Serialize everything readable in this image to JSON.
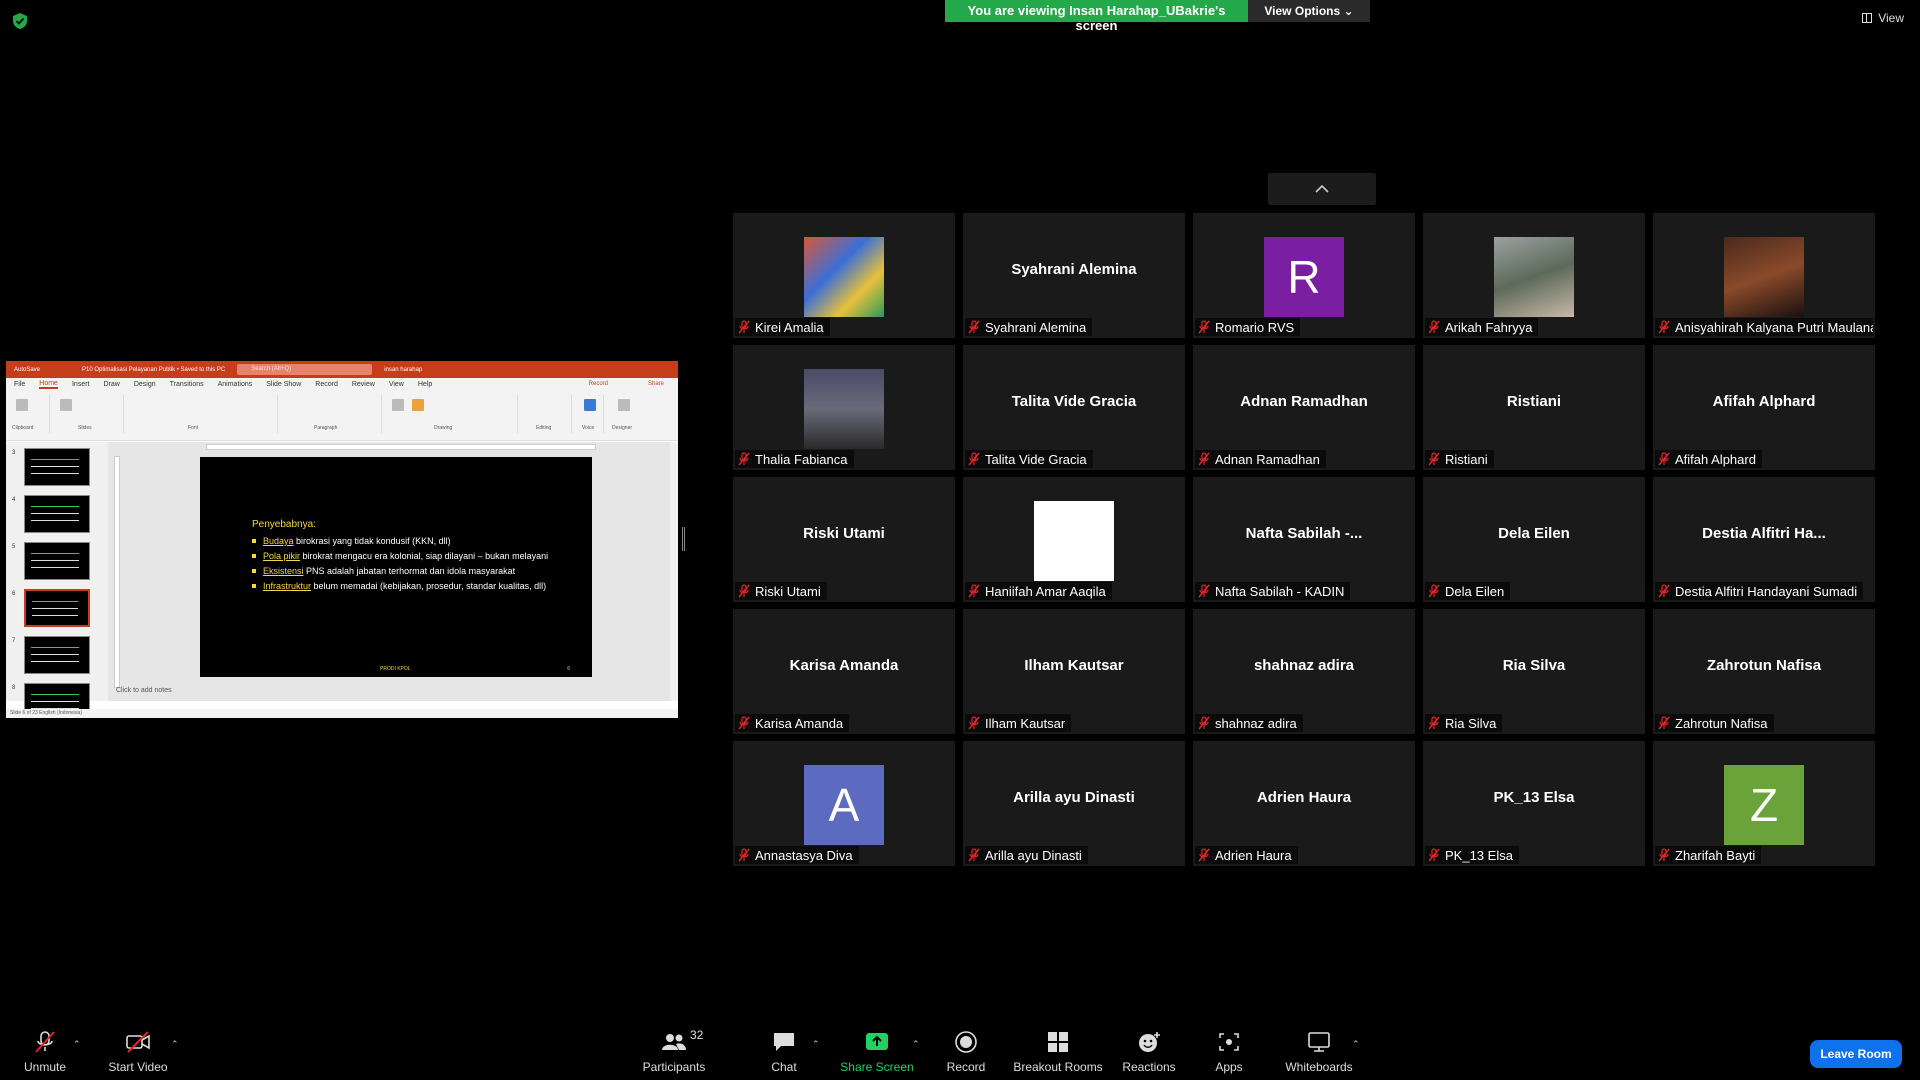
{
  "top": {
    "share_banner": "You are viewing Insan Harahap_UBakrie's screen",
    "view_options": "View Options",
    "view_label": "View"
  },
  "colors": {
    "share_green": "#23a84a",
    "leave_blue": "#0e72ed",
    "ppt_red": "#c43e1c",
    "tile_bg": "#1a1a1a"
  },
  "gallery": {
    "tiles": [
      {
        "center": "",
        "label": "Kirei Amalia",
        "kind": "photo"
      },
      {
        "center": "Syahrani Alemina",
        "label": "Syahrani Alemina",
        "kind": "name"
      },
      {
        "center": "R",
        "label": "Romario RVS",
        "kind": "avatar",
        "color": "#7b1fa2"
      },
      {
        "center": "",
        "label": "Arikah Fahryya",
        "kind": "photo"
      },
      {
        "center": "",
        "label": "Anisyahirah Kalyana Putri Maulana",
        "kind": "photo"
      },
      {
        "center": "",
        "label": "Thalia Fabianca",
        "kind": "photo"
      },
      {
        "center": "Talita Vide Gracia",
        "label": "Talita Vide Gracia",
        "kind": "name"
      },
      {
        "center": "Adnan Ramadhan",
        "label": "Adnan Ramadhan",
        "kind": "name"
      },
      {
        "center": "Ristiani",
        "label": "Ristiani",
        "kind": "name"
      },
      {
        "center": "Afifah Alphard",
        "label": "Afifah Alphard",
        "kind": "name"
      },
      {
        "center": "Riski Utami",
        "label": "Riski Utami",
        "kind": "name"
      },
      {
        "center": "",
        "label": "Haniifah Amar Aaqila",
        "kind": "blank"
      },
      {
        "center": "Nafta Sabilah -...",
        "label": "Nafta Sabilah - KADIN",
        "kind": "name"
      },
      {
        "center": "Dela Eilen",
        "label": "Dela Eilen",
        "kind": "name"
      },
      {
        "center": "Destia Alfitri Ha...",
        "label": "Destia Alfitri Handayani Sumadi",
        "kind": "name"
      },
      {
        "center": "Karisa Amanda",
        "label": "Karisa Amanda",
        "kind": "name"
      },
      {
        "center": "Ilham Kautsar",
        "label": "Ilham Kautsar",
        "kind": "name"
      },
      {
        "center": "shahnaz adira",
        "label": "shahnaz adira",
        "kind": "name"
      },
      {
        "center": "Ria Silva",
        "label": "Ria Silva",
        "kind": "name"
      },
      {
        "center": "Zahrotun Nafisa",
        "label": "Zahrotun Nafisa",
        "kind": "name"
      },
      {
        "center": "A",
        "label": "Annastasya Diva",
        "kind": "avatar",
        "color": "#5c6bc0"
      },
      {
        "center": "Arilla ayu Dinasti",
        "label": "Arilla ayu Dinasti",
        "kind": "name"
      },
      {
        "center": "Adrien Haura",
        "label": "Adrien Haura",
        "kind": "name"
      },
      {
        "center": "PK_13 Elsa",
        "label": "PK_13 Elsa",
        "kind": "name"
      },
      {
        "center": "Z",
        "label": "Zharifah Bayti",
        "kind": "avatar",
        "color": "#6aa33a"
      }
    ]
  },
  "ppt": {
    "autosave": "AutoSave",
    "file_title": "P10 Optimalisasi Pelayanan Publik • Saved to this PC",
    "search": "Search (Alt+Q)",
    "user": "insan harahap",
    "tabs": [
      "File",
      "Home",
      "Insert",
      "Draw",
      "Design",
      "Transitions",
      "Animations",
      "Slide Show",
      "Record",
      "Review",
      "View",
      "Help"
    ],
    "active_tab": "Home",
    "record_btn": "Record",
    "share_btn": "Share",
    "groups": [
      "Clipboard",
      "Slides",
      "Font",
      "Paragraph",
      "Drawing",
      "Editing",
      "Voice",
      "Designer"
    ],
    "slide_numbers": [
      "3",
      "4",
      "5",
      "6",
      "7",
      "8"
    ],
    "slide": {
      "heading": "Penyebabnya:",
      "items": [
        {
          "kw": "Budaya",
          "rest": " birokrasi yang tidak kondusif (KKN, dll)"
        },
        {
          "kw": "Pola pikir",
          "rest": " birokrat mengacu era kolonial, siap dilayani – bukan melayani"
        },
        {
          "kw": "Eksistensi",
          "rest": " PNS adalah jabatan terhormat dan idola masyarakat"
        },
        {
          "kw": "Infrastruktur",
          "rest": " belum memadai (kebijakan, prosedur, standar kualitas, dll)"
        }
      ],
      "footer": "PRODI KPOL",
      "number": "6"
    },
    "notes": "Click to add notes",
    "status": "Slide 6 of 23    English (Indonesia)"
  },
  "toolbar": {
    "unmute": "Unmute",
    "start_video": "Start Video",
    "participants": "Participants",
    "participants_count": "32",
    "chat": "Chat",
    "share_screen": "Share Screen",
    "record": "Record",
    "breakout_rooms": "Breakout Rooms",
    "reactions": "Reactions",
    "apps": "Apps",
    "whiteboards": "Whiteboards",
    "leave": "Leave Room"
  }
}
